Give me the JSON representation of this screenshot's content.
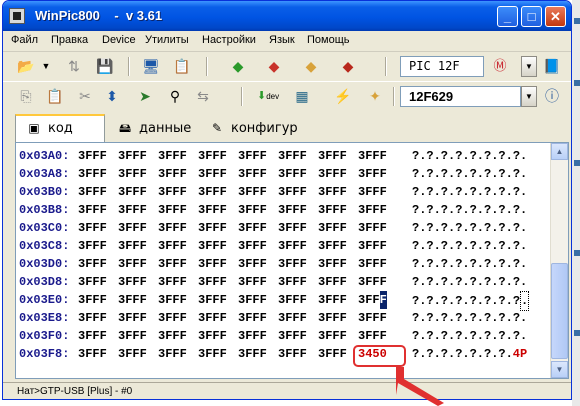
{
  "window": {
    "title": "WinPic800    -  v 3.61",
    "buttons": {
      "minimize": "_",
      "maximize": "□",
      "close": "✕"
    }
  },
  "menu": [
    "Файл",
    "Правка",
    "Device",
    "Утилиты",
    "Настройки",
    "Язык",
    "Помощь"
  ],
  "toolbar": {
    "family_select": {
      "value": "PIC 12F"
    },
    "device_select": {
      "value": "12F629"
    },
    "dev_label": "dev"
  },
  "tabs": [
    {
      "label": "код",
      "icon": "code-icon",
      "active": true
    },
    {
      "label": "данные",
      "icon": "data-icon",
      "active": false
    },
    {
      "label": "конфигур",
      "icon": "config-icon",
      "active": false
    }
  ],
  "hex": {
    "rows": [
      {
        "addr": "0x03A0:",
        "cells": [
          "3FFF",
          "3FFF",
          "3FFF",
          "3FFF",
          "3FFF",
          "3FFF",
          "3FFF",
          "3FFF"
        ],
        "ascii": "?.?.?.?.?.?.?.?."
      },
      {
        "addr": "0x03A8:",
        "cells": [
          "3FFF",
          "3FFF",
          "3FFF",
          "3FFF",
          "3FFF",
          "3FFF",
          "3FFF",
          "3FFF"
        ],
        "ascii": "?.?.?.?.?.?.?.?."
      },
      {
        "addr": "0x03B0:",
        "cells": [
          "3FFF",
          "3FFF",
          "3FFF",
          "3FFF",
          "3FFF",
          "3FFF",
          "3FFF",
          "3FFF"
        ],
        "ascii": "?.?.?.?.?.?.?.?."
      },
      {
        "addr": "0x03B8:",
        "cells": [
          "3FFF",
          "3FFF",
          "3FFF",
          "3FFF",
          "3FFF",
          "3FFF",
          "3FFF",
          "3FFF"
        ],
        "ascii": "?.?.?.?.?.?.?.?."
      },
      {
        "addr": "0x03C0:",
        "cells": [
          "3FFF",
          "3FFF",
          "3FFF",
          "3FFF",
          "3FFF",
          "3FFF",
          "3FFF",
          "3FFF"
        ],
        "ascii": "?.?.?.?.?.?.?.?."
      },
      {
        "addr": "0x03C8:",
        "cells": [
          "3FFF",
          "3FFF",
          "3FFF",
          "3FFF",
          "3FFF",
          "3FFF",
          "3FFF",
          "3FFF"
        ],
        "ascii": "?.?.?.?.?.?.?.?."
      },
      {
        "addr": "0x03D0:",
        "cells": [
          "3FFF",
          "3FFF",
          "3FFF",
          "3FFF",
          "3FFF",
          "3FFF",
          "3FFF",
          "3FFF"
        ],
        "ascii": "?.?.?.?.?.?.?.?."
      },
      {
        "addr": "0x03D8:",
        "cells": [
          "3FFF",
          "3FFF",
          "3FFF",
          "3FFF",
          "3FFF",
          "3FFF",
          "3FFF",
          "3FFF"
        ],
        "ascii": "?.?.?.?.?.?.?.?."
      },
      {
        "addr": "0x03E0:",
        "cells": [
          "3FFF",
          "3FFF",
          "3FFF",
          "3FFF",
          "3FFF",
          "3FFF",
          "3FFF",
          "3FFF"
        ],
        "ascii": "?.?.?.?.?.?.?.?."
      },
      {
        "addr": "0x03E8:",
        "cells": [
          "3FFF",
          "3FFF",
          "3FFF",
          "3FFF",
          "3FFF",
          "3FFF",
          "3FFF",
          "3FFF"
        ],
        "ascii": "?.?.?.?.?.?.?.?."
      },
      {
        "addr": "0x03F0:",
        "cells": [
          "3FFF",
          "3FFF",
          "3FFF",
          "3FFF",
          "3FFF",
          "3FFF",
          "3FFF",
          "3FFF"
        ],
        "ascii": "?.?.?.?.?.?.?.?."
      },
      {
        "addr": "0x03F8:",
        "cells": [
          "3FFF",
          "3FFF",
          "3FFF",
          "3FFF",
          "3FFF",
          "3FFF",
          "3FFF",
          "3450"
        ],
        "ascii": "?.?.?.?.?.?.?.",
        "ascii_tail": "4P"
      }
    ],
    "cursor_row": 8,
    "highlight_row": 11,
    "highlight_col": 7
  },
  "status": {
    "text": "Нат>GTP-USB [Plus] - #0"
  },
  "colors": {
    "titlebar": "#0054e3",
    "highlight": "#cc0000",
    "annotation": "#e03030",
    "address": "#1a1a8c"
  }
}
